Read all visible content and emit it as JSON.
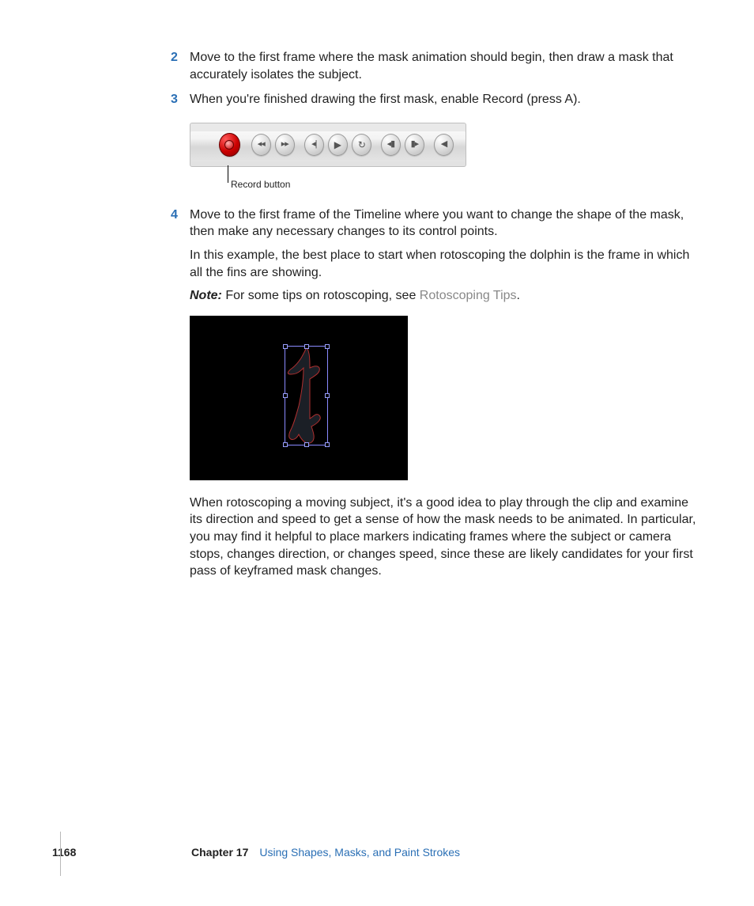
{
  "steps": {
    "s2": {
      "num": "2",
      "text": "Move to the first frame where the mask animation should begin, then draw a mask that accurately isolates the subject."
    },
    "s3": {
      "num": "3",
      "text": "When you're finished drawing the first mask, enable Record (press A)."
    },
    "s4": {
      "num": "4",
      "p1": "Move to the first frame of the Timeline where you want to change the shape of the mask, then make any necessary changes to its control points.",
      "p2": "In this example, the best place to start when rotoscoping the dolphin is the frame in which all the fins are showing.",
      "note_label": "Note:",
      "note_text": "  For some tips on rotoscoping, see ",
      "note_link": "Rotoscoping Tips",
      "note_tail": "."
    }
  },
  "toolbar": {
    "callout": "Record button",
    "icons": {
      "record": "record-icon",
      "prev": "◂◂",
      "next": "▸▸",
      "step_back": "◂|",
      "play": "▶",
      "loop": "↻",
      "nudge_back": "◂▮",
      "nudge_fwd": "▮▸",
      "mute": "◀"
    }
  },
  "body_after": "When rotoscoping a moving subject, it's a good idea to play through the clip and examine its direction and speed to get a sense of how the mask needs to be animated. In particular, you may find it helpful to place markers indicating frames where the subject or camera stops, changes direction, or changes speed, since these are likely candidates for your first pass of keyframed mask changes.",
  "footer": {
    "page": "1168",
    "chapter_label": "Chapter 17",
    "chapter_title": "Using Shapes, Masks, and Paint Strokes"
  }
}
